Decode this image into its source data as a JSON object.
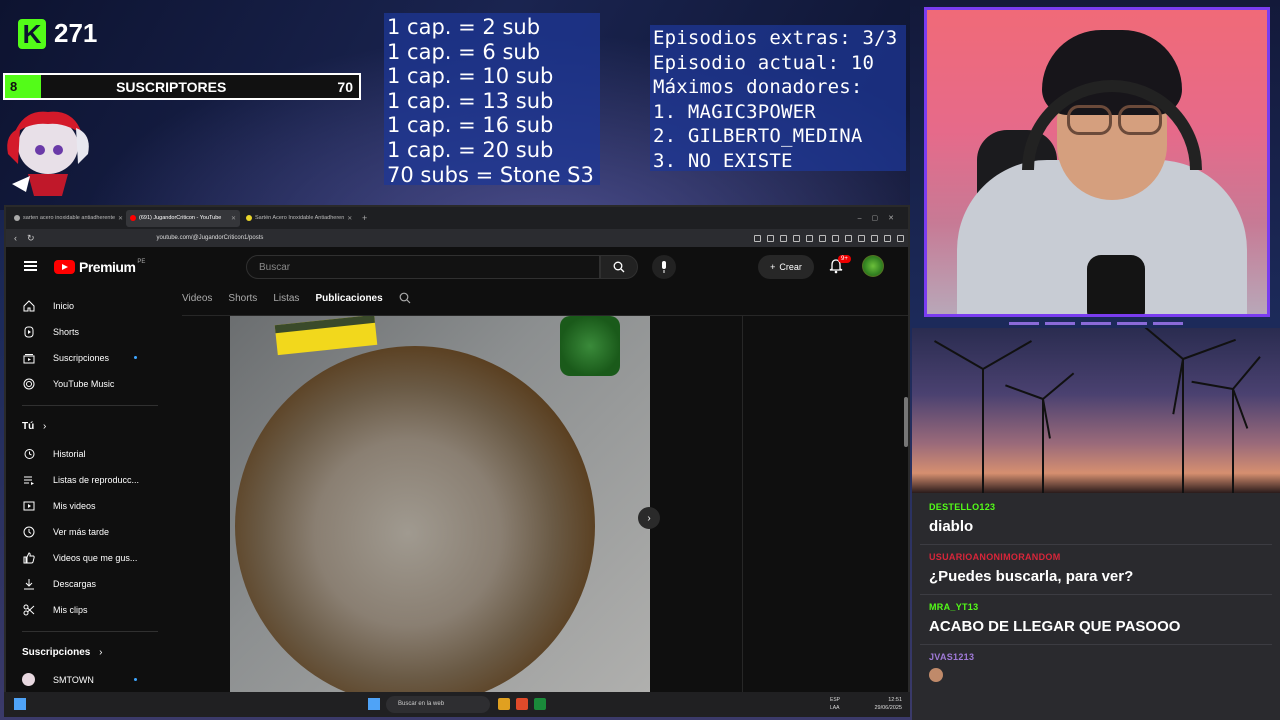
{
  "overlay": {
    "kick": {
      "logo": "K",
      "count": "271"
    },
    "subs_bar": {
      "current": "8",
      "label": "SUSCRIPTORES",
      "goal": "70",
      "progress_fraction": 0.114
    },
    "goals": [
      "1 cap. = 2 sub",
      "1 cap. = 6 sub",
      "1 cap. = 10 sub",
      "1 cap. = 13 sub",
      "1 cap. = 16 sub",
      "1 cap. = 20 sub",
      "70 subs = Stone S3"
    ],
    "episodes": [
      "Episodios extras: 3/3",
      "Episodio actual: 10",
      "Máximos donadores:",
      "1. MAGIC3POWER",
      "2. GILBERTO_MEDINA",
      "3. NO EXISTE"
    ]
  },
  "chat": [
    {
      "user": "DESTELLO123",
      "color": "#53fc18",
      "text": "diablo"
    },
    {
      "user": "USUARIOANONIMORANDOM",
      "color": "#d8263a",
      "text": "¿Puedes buscarla, para ver?"
    },
    {
      "user": "MRA_YT13",
      "color": "#53fc18",
      "text": "ACABO DE LLEGAR QUE PASOOO"
    },
    {
      "user": "JVAS1213",
      "color": "#a07ad8",
      "text": ""
    }
  ],
  "browser": {
    "tabs": [
      {
        "label": "sarten acero inoxidable antiadherente",
        "active": false
      },
      {
        "label": "(691) JugandorCriticon - YouTube",
        "active": true
      },
      {
        "label": "Sartén Acero Inoxidable Antiadheren",
        "active": false
      }
    ],
    "url": "youtube.com/@JugandorCriticon1/posts"
  },
  "youtube": {
    "brand": "Premium",
    "region": "PE",
    "search_placeholder": "Buscar",
    "create_label": "Crear",
    "notif_badge": "9+",
    "sidebar_main": [
      {
        "label": "Inicio",
        "icon": "home-icon",
        "dot": false
      },
      {
        "label": "Shorts",
        "icon": "shorts-icon",
        "dot": false
      },
      {
        "label": "Suscripciones",
        "icon": "subscriptions-icon",
        "dot": true
      },
      {
        "label": "YouTube Music",
        "icon": "music-icon",
        "dot": false
      }
    ],
    "you_heading": "Tú",
    "sidebar_you": [
      {
        "label": "Historial",
        "icon": "history-icon"
      },
      {
        "label": "Listas de reproducc...",
        "icon": "playlist-icon"
      },
      {
        "label": "Mis videos",
        "icon": "video-icon"
      },
      {
        "label": "Ver más tarde",
        "icon": "clock-icon"
      },
      {
        "label": "Videos que me gus...",
        "icon": "like-icon"
      },
      {
        "label": "Descargas",
        "icon": "download-icon"
      },
      {
        "label": "Mis clips",
        "icon": "scissors-icon"
      }
    ],
    "subs_heading": "Suscripciones",
    "subscriptions": [
      {
        "label": "SMTOWN",
        "dot": true
      }
    ],
    "channel_tabs": [
      "Videos",
      "Shorts",
      "Listas",
      "Publicaciones"
    ],
    "active_tab": "Publicaciones"
  },
  "taskbar": {
    "search_placeholder": "Buscar en la web",
    "lang": "ESP\nLAA",
    "time": "12:51",
    "date": "29/06/2025"
  }
}
